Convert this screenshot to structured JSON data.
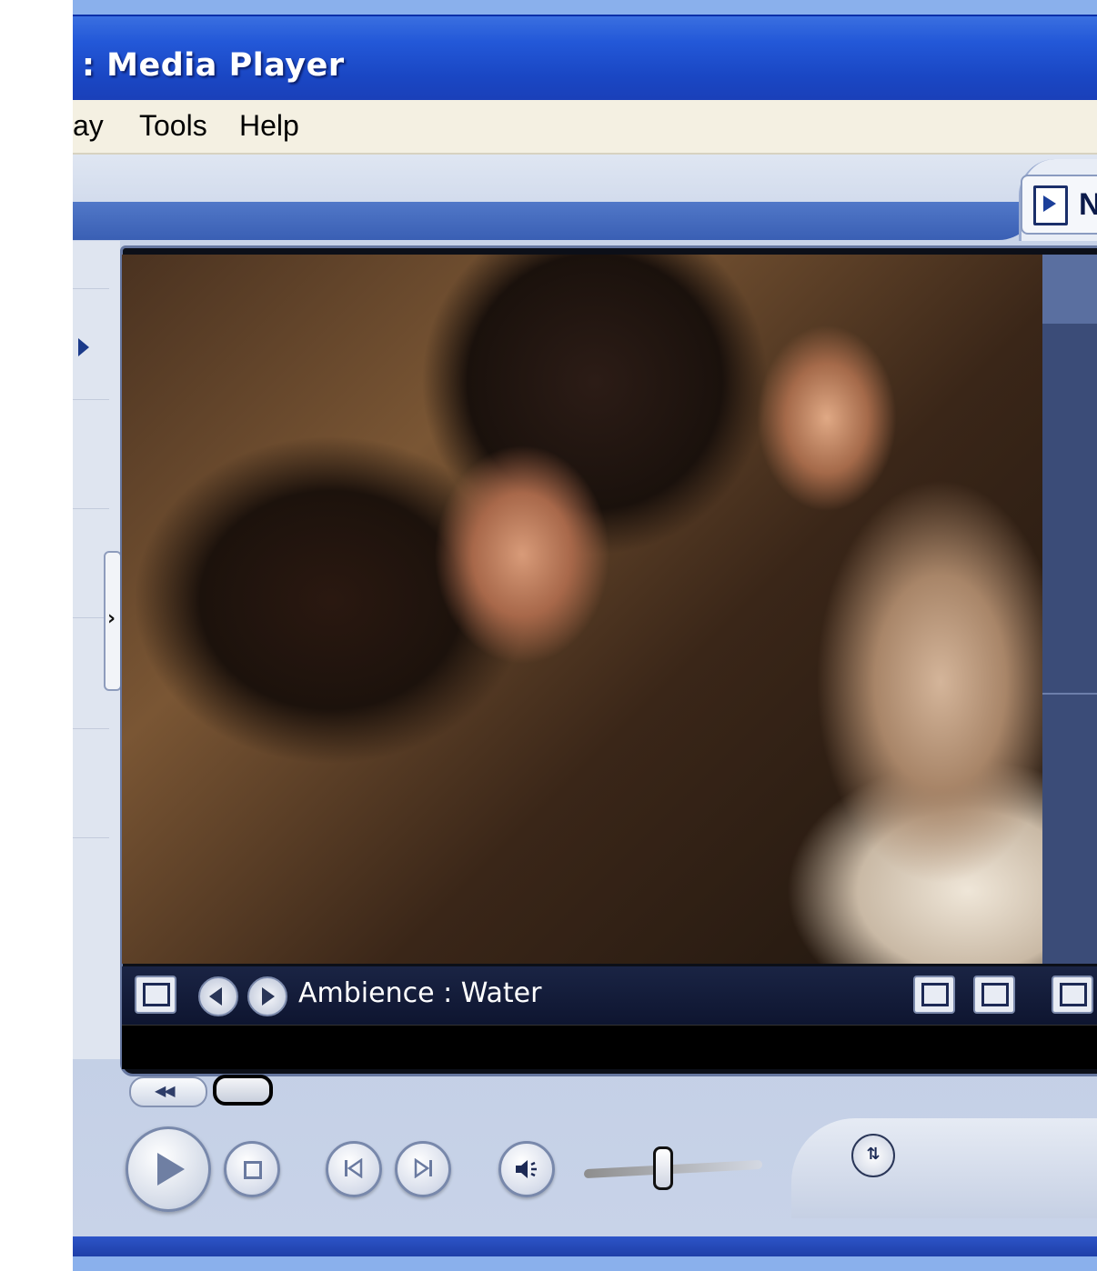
{
  "window": {
    "title": ": Media Player"
  },
  "menu": {
    "items": [
      "ay",
      "Tools",
      "Help"
    ]
  },
  "taskbar": {
    "now_playing_label": "N"
  },
  "info": {
    "text": "Ambience : Water"
  },
  "colors": {
    "title_bar": "#2358d8",
    "menu_bar": "#f4f0e2",
    "info_bar": "#0e1530",
    "chrome": "#c8d3e8"
  },
  "icons": {
    "now_playing": "now-playing-icon",
    "side_expand": "triangle-right-icon",
    "panel_toggle": "chevron-right-icon",
    "visualization": "visualization-icon",
    "prev_vis": "arrow-left-icon",
    "next_vis": "arrow-right-icon",
    "compact_mode": "compact-mode-icon",
    "full_screen": "full-screen-icon",
    "play": "play-icon",
    "stop": "stop-icon",
    "previous": "previous-track-icon",
    "next": "next-track-icon",
    "mute": "speaker-icon",
    "shuffle": "shuffle-icon"
  }
}
